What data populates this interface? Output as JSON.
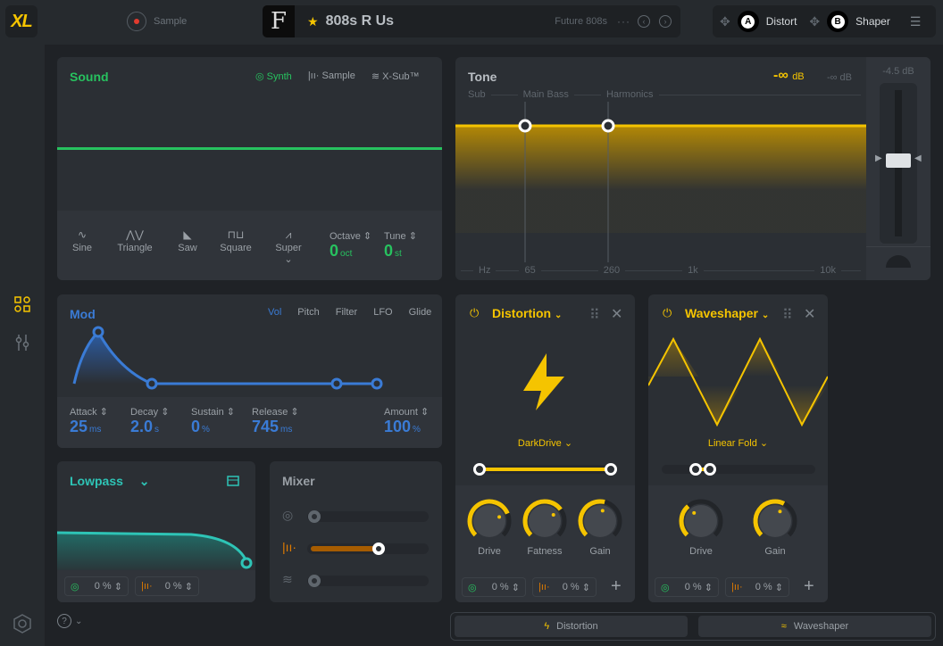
{
  "app": {
    "logo": "XL"
  },
  "header": {
    "record_label": "Sample",
    "preset_art_glyph": "F",
    "preset_name": "808s R Us",
    "preset_category": "Future 808s",
    "more_icon": "···",
    "prev_icon": "‹",
    "next_icon": "›",
    "favorite_icon": "★",
    "fx_slots": [
      {
        "badge": "A",
        "label": "Distort"
      },
      {
        "badge": "B",
        "label": "Shaper"
      }
    ],
    "move_icon": "✥",
    "list_icon": "☰"
  },
  "sound": {
    "title": "Sound",
    "tabs": [
      {
        "icon": "◎",
        "label": "Synth",
        "active": true
      },
      {
        "icon": "|ıı·",
        "label": "Sample",
        "active": false
      },
      {
        "icon": "≋",
        "label": "X-Sub™",
        "active": false
      }
    ],
    "waveforms": [
      {
        "glyph": "∿",
        "label": "Sine",
        "active": true
      },
      {
        "glyph": "⋀⋁",
        "label": "Triangle",
        "active": false
      },
      {
        "glyph": "◣",
        "label": "Saw",
        "active": false
      },
      {
        "glyph": "⊓⊔",
        "label": "Square",
        "active": false
      },
      {
        "glyph": "⩘",
        "label": "Super",
        "active": false
      }
    ],
    "super_chevron": "⌄",
    "octave": {
      "label": "Octave",
      "value": "0",
      "unit": "oct"
    },
    "tune": {
      "label": "Tune",
      "value": "0",
      "unit": "st"
    },
    "spinner_icon": "⇕"
  },
  "tone": {
    "title": "Tone",
    "db_active": "-∞",
    "db_unit": "dB",
    "db_inactive": "-∞ dB",
    "bands": [
      "Sub",
      "Main Bass",
      "Harmonics"
    ],
    "freq_labels": [
      "Hz",
      "65",
      "260",
      "1k",
      "10k"
    ],
    "crossover_hz": [
      65,
      260
    ],
    "output_db": "-4.5 dB"
  },
  "mod": {
    "title": "Mod",
    "tabs": [
      {
        "label": "Vol",
        "active": true
      },
      {
        "label": "Pitch",
        "active": false
      },
      {
        "label": "Filter",
        "active": false
      },
      {
        "label": "LFO",
        "active": false
      },
      {
        "label": "Glide",
        "active": false
      }
    ],
    "params": [
      {
        "label": "Attack",
        "value": "25",
        "unit": "ms"
      },
      {
        "label": "Decay",
        "value": "2.0",
        "unit": "s"
      },
      {
        "label": "Sustain",
        "value": "0",
        "unit": "%"
      },
      {
        "label": "Release",
        "value": "745",
        "unit": "ms"
      },
      {
        "label": "Amount",
        "value": "100",
        "unit": "%"
      }
    ]
  },
  "filter": {
    "title": "Lowpass",
    "chevron": "⌄",
    "chips": [
      {
        "icon": "◎",
        "value": "0 %"
      },
      {
        "icon": "|ıı·",
        "value": "0 %"
      }
    ]
  },
  "mixer": {
    "title": "Mixer",
    "channels": [
      {
        "icon": "◎",
        "level": 0.0
      },
      {
        "icon": "|ıı·",
        "level": 0.6
      },
      {
        "icon": "≋",
        "level": 0.0
      }
    ]
  },
  "distortion": {
    "title": "Distortion",
    "type": "DarkDrive",
    "range": [
      0.0,
      1.0
    ],
    "knobs": [
      {
        "label": "Drive",
        "value": 0.75
      },
      {
        "label": "Fatness",
        "value": 0.7
      },
      {
        "label": "Gain",
        "value": 0.55
      }
    ],
    "chips": [
      {
        "icon": "◎",
        "value": "0 %"
      },
      {
        "icon": "|ıı·",
        "value": "0 %"
      }
    ],
    "add_icon": "+"
  },
  "waveshaper": {
    "title": "Waveshaper",
    "type": "Linear Fold",
    "range": [
      0.2,
      0.3
    ],
    "knobs": [
      {
        "label": "Drive",
        "value": 0.35
      },
      {
        "label": "Gain",
        "value": 0.6
      }
    ],
    "chips": [
      {
        "icon": "◎",
        "value": "0 %"
      },
      {
        "icon": "|ıı·",
        "value": "0 %"
      }
    ],
    "add_icon": "+"
  },
  "bottom_tabs": [
    {
      "icon": "ϟ",
      "label": "Distortion"
    },
    {
      "icon": "≈",
      "label": "Waveshaper"
    }
  ],
  "help": {
    "icon": "?",
    "chevron": "⌄"
  }
}
